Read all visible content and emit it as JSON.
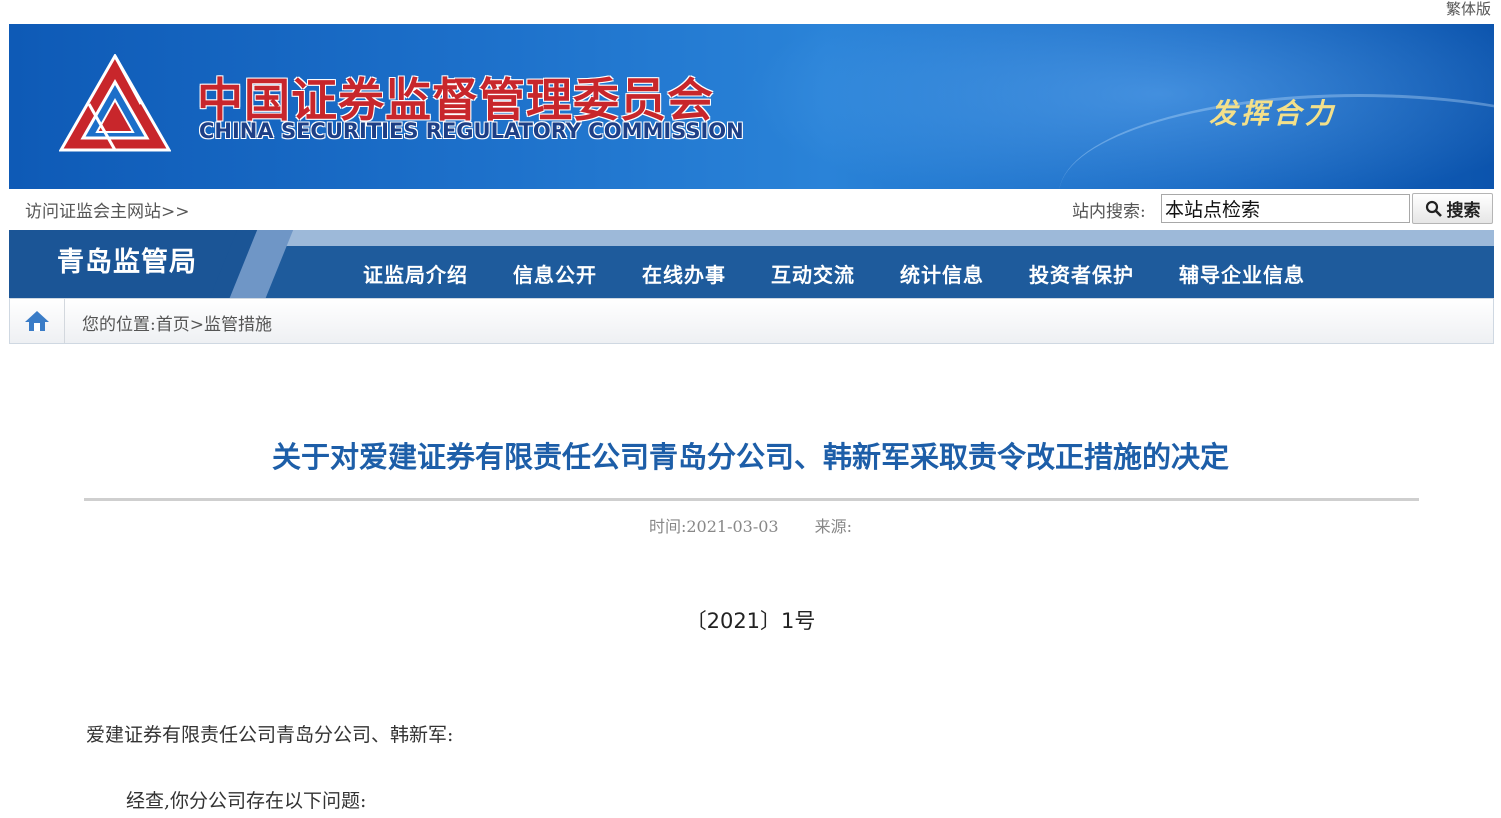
{
  "top_links": {
    "traditional": "繁体版"
  },
  "banner": {
    "title_cn": "中国证券监督管理委员会",
    "title_en": "CHINA SECURITIES REGULATORY COMMISSION",
    "slogan": "发挥合力",
    "colors": {
      "logo_red": "#c8262b",
      "banner_blue": "#1c6fc9"
    }
  },
  "search": {
    "visit_link": "访问证监会主网站>>",
    "label": "站内搜索:",
    "input_value": "本站点检索",
    "button_label": "搜索"
  },
  "nav": {
    "bureau": "青岛监管局",
    "items": [
      "证监局介绍",
      "信息公开",
      "在线办事",
      "互动交流",
      "统计信息",
      "投资者保护",
      "辅导企业信息"
    ]
  },
  "breadcrumb": {
    "prefix": "您的位置:",
    "home": "首页",
    "separator": ">",
    "current": "监管措施"
  },
  "article": {
    "title": "关于对爱建证券有限责任公司青岛分公司、韩新军采取责令改正措施的决定",
    "time": "时间:2021-03-03",
    "source": "来源:",
    "doc_number": "〔2021〕1号",
    "salutation": "爱建证券有限责任公司青岛分公司、韩新军:",
    "para1": "经查,你分公司存在以下问题:"
  }
}
